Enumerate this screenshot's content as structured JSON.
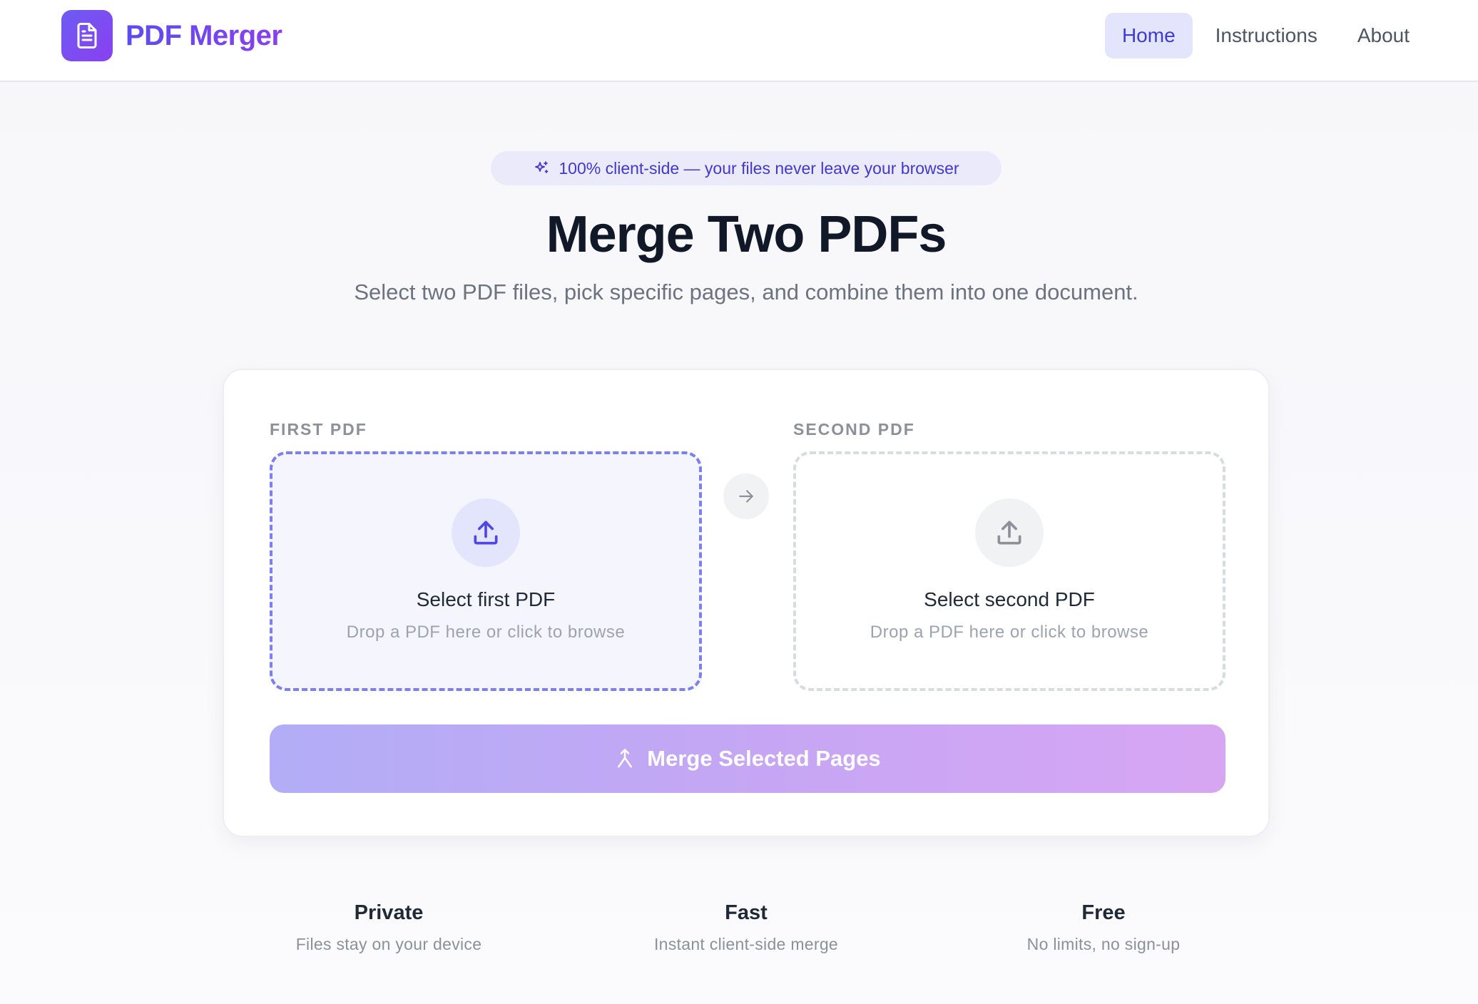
{
  "app": {
    "name": "PDF Merger",
    "logo_icon": "document-icon",
    "brand_gradient": [
      "#6d5cf2",
      "#8b3ff0"
    ]
  },
  "nav": {
    "items": [
      {
        "label": "Home",
        "active": true
      },
      {
        "label": "Instructions",
        "active": false
      },
      {
        "label": "About",
        "active": false
      }
    ]
  },
  "hero": {
    "badge": "100% client-side — your files never leave your browser",
    "badge_icon": "sparkles-icon",
    "title": "Merge Two PDFs",
    "subtitle": "Select two PDF files, pick specific pages, and combine them into one document."
  },
  "uploader": {
    "first": {
      "label": "FIRST PDF",
      "title": "Select first PDF",
      "hint": "Drop a PDF here or click to browse",
      "icon": "upload-icon",
      "accent": "#7c7ff0"
    },
    "second": {
      "label": "SECOND PDF",
      "title": "Select second PDF",
      "hint": "Drop a PDF here or click to browse",
      "icon": "upload-icon"
    },
    "arrow_icon": "arrow-right-icon",
    "merge_button": {
      "label": "Merge Selected Pages",
      "icon": "merge-icon",
      "disabled": true
    }
  },
  "features": [
    {
      "title": "Private",
      "description": "Files stay on your device"
    },
    {
      "title": "Fast",
      "description": "Instant client-side merge"
    },
    {
      "title": "Free",
      "description": "No limits, no sign-up"
    }
  ]
}
